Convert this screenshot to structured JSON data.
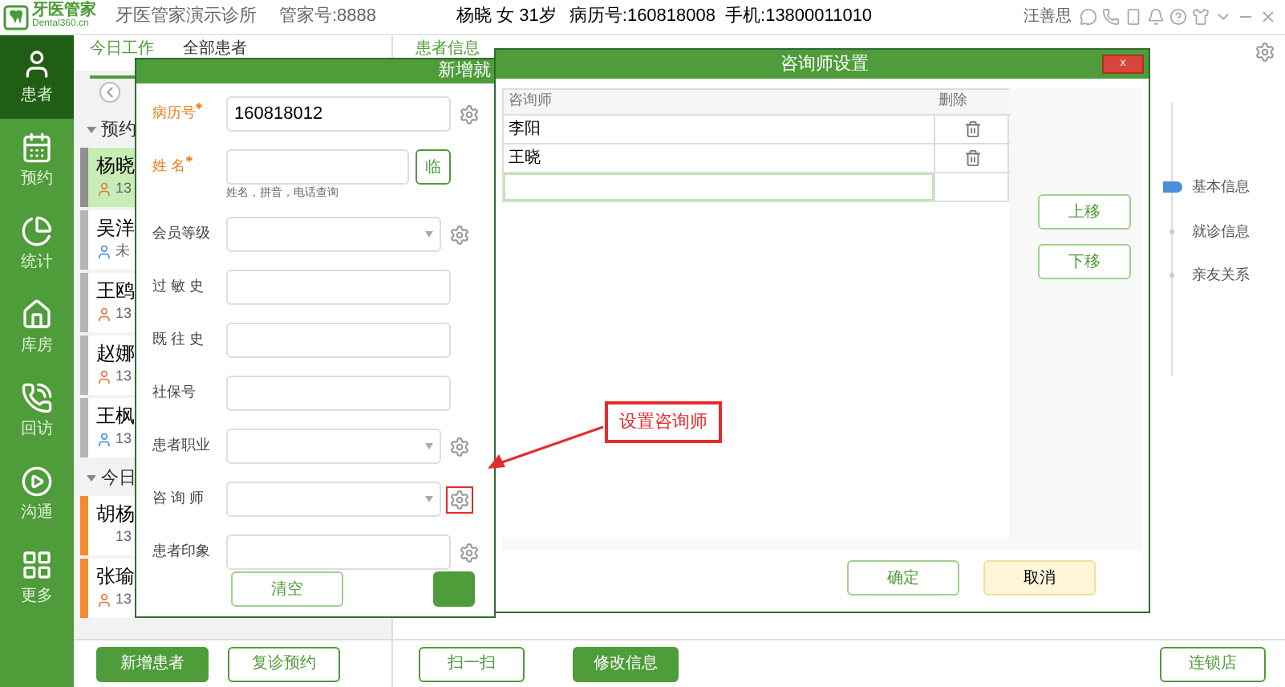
{
  "header": {
    "logo_name": "牙医管家",
    "logo_sub": "Dental360.cn",
    "clinic": "牙医管家演示诊所",
    "account": "管家号:8888",
    "patient": "杨晓 女 31岁",
    "record_no": "病历号:160818008",
    "phone": "手机:13800011010",
    "user": "汪善思"
  },
  "sidebar": [
    {
      "label": "患者",
      "selected": true
    },
    {
      "label": "预约",
      "selected": false
    },
    {
      "label": "统计",
      "selected": false
    },
    {
      "label": "库房",
      "selected": false
    },
    {
      "label": "回访",
      "selected": false
    },
    {
      "label": "沟通",
      "selected": false
    },
    {
      "label": "更多",
      "selected": false
    }
  ],
  "list_tabs": [
    {
      "label": "今日工作",
      "selected": true
    },
    {
      "label": "全部患者",
      "selected": false
    }
  ],
  "info_tabs": [
    {
      "label": "患者信息",
      "selected": true
    }
  ],
  "patient_groups": [
    {
      "label": "预约",
      "expanded": true,
      "patients": [
        {
          "name": "杨晓",
          "info": "13",
          "kind": "female",
          "selected": true,
          "color": "#8f8f8f"
        },
        {
          "name": "吴洋",
          "info": "未",
          "kind": "male",
          "selected": false,
          "color": "#b5b5b5"
        },
        {
          "name": "王鸥",
          "info": "13",
          "kind": "female",
          "selected": false,
          "color": "#b5b5b5"
        },
        {
          "name": "赵娜",
          "info": "13",
          "kind": "female",
          "selected": false,
          "color": "#b5b5b5"
        },
        {
          "name": "王枫",
          "info": "13",
          "kind": "male",
          "selected": false,
          "color": "#b5b5b5"
        }
      ]
    },
    {
      "label": "今日",
      "expanded": true,
      "patients": [
        {
          "name": "胡杨",
          "info": "13",
          "kind": "none",
          "selected": false,
          "color": "#f5892e"
        },
        {
          "name": "张瑜",
          "info": "13",
          "kind": "female",
          "selected": false,
          "color": "#f5892e"
        }
      ]
    }
  ],
  "timeline": [
    {
      "label": "基本信息",
      "selected": true
    },
    {
      "label": "就诊信息",
      "selected": false
    },
    {
      "label": "亲友关系",
      "selected": false
    }
  ],
  "bottom_buttons": [
    {
      "label": "新增患者",
      "primary": true
    },
    {
      "label": "复诊预约",
      "primary": false
    },
    {
      "label": "扫一扫",
      "primary": false
    },
    {
      "label": "修改信息",
      "primary": true
    },
    {
      "label": "连锁店",
      "primary": false
    }
  ],
  "new_visit_dialog": {
    "title": "新增就",
    "fields": [
      {
        "label": "病历号",
        "required": true,
        "kind": "input",
        "value": "160818012",
        "gear": true,
        "highlighted": false
      },
      {
        "label": "姓 名",
        "required": true,
        "kind": "input_button",
        "button": "临",
        "hint": "姓名，拼音，电话查询"
      },
      {
        "label": "会员等级",
        "required": false,
        "kind": "select",
        "gear": true,
        "highlighted": false
      },
      {
        "label": "过 敏 史",
        "required": false,
        "kind": "input"
      },
      {
        "label": "既 往 史",
        "required": false,
        "kind": "input"
      },
      {
        "label": "社保号",
        "required": false,
        "kind": "input"
      },
      {
        "label": "患者职业",
        "required": false,
        "kind": "select",
        "gear": true,
        "highlighted": false
      },
      {
        "label": "咨 询 师",
        "required": false,
        "kind": "select",
        "gear": true,
        "highlighted": true
      },
      {
        "label": "患者印象",
        "required": false,
        "kind": "input",
        "gear": true,
        "highlighted": false
      }
    ],
    "buttons": [
      {
        "label": "清空",
        "primary": false
      },
      {
        "primary": true
      }
    ]
  },
  "consultant_dialog": {
    "title": "咨询师设置",
    "close": "x",
    "columns": [
      "咨询师",
      "删除"
    ],
    "rows": [
      {
        "name": "李阳"
      },
      {
        "name": "王晓"
      }
    ],
    "side_buttons": [
      "上移",
      "下移"
    ],
    "buttons": [
      {
        "label": "确定",
        "kind": "default"
      },
      {
        "label": "取消",
        "kind": "highlight"
      }
    ]
  },
  "annotation": {
    "label": "设置咨询师"
  }
}
